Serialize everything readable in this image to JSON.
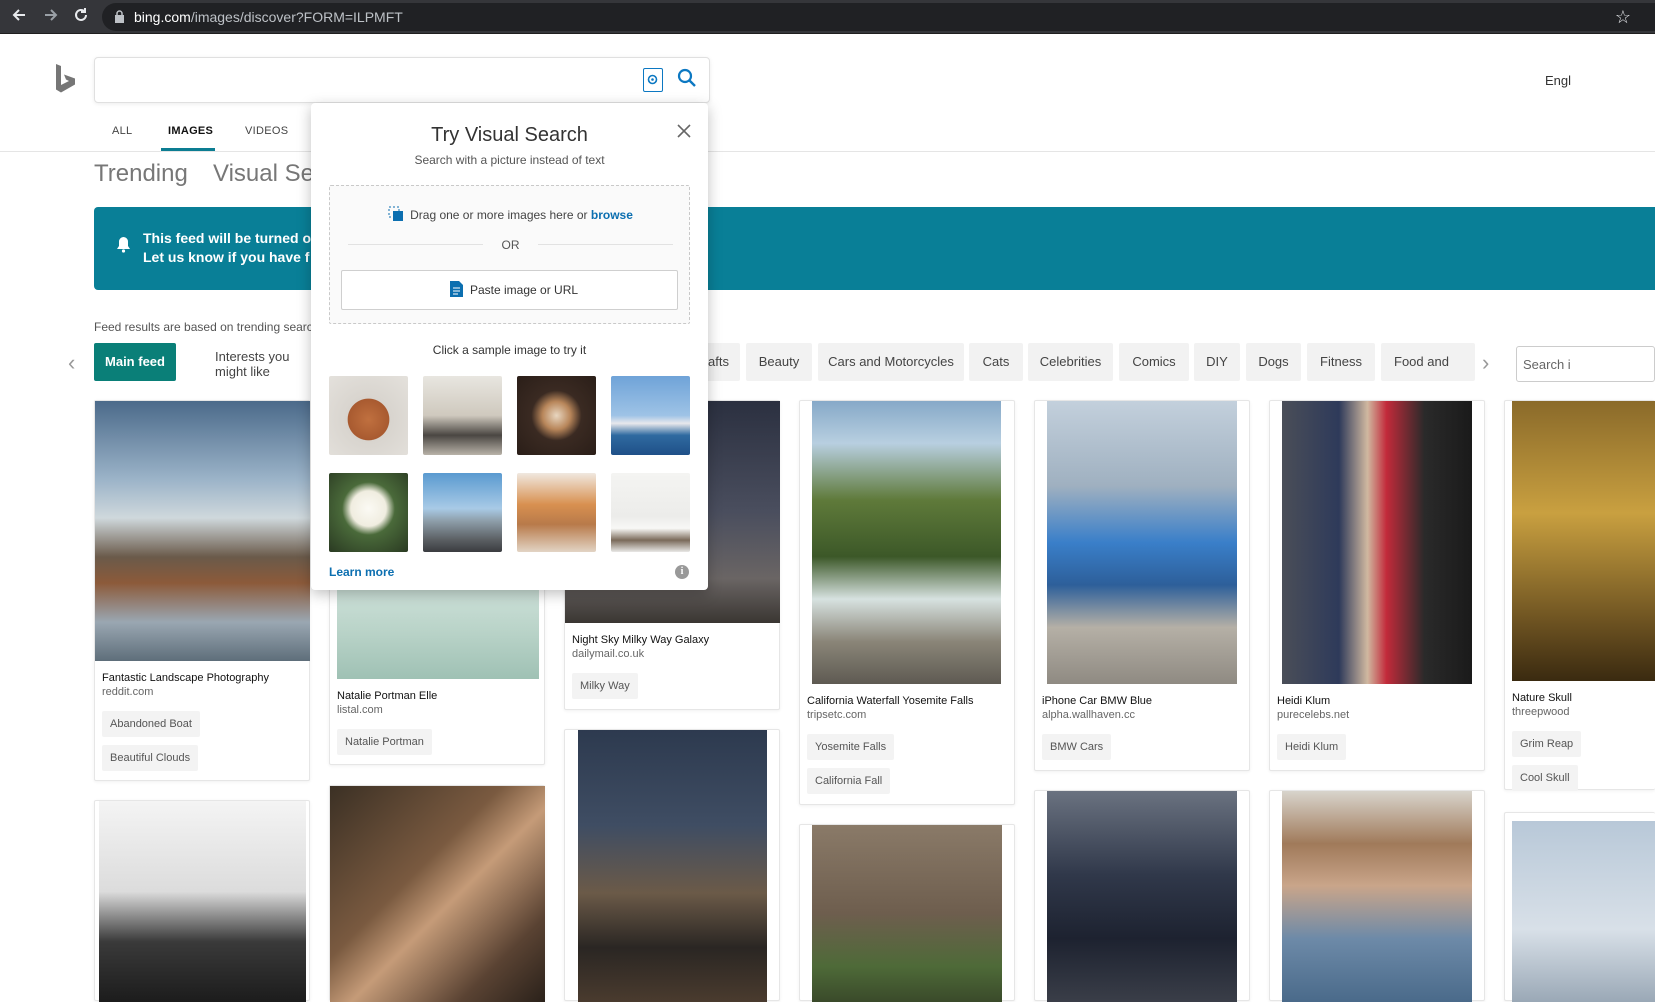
{
  "browser": {
    "url_domain": "bing.com",
    "url_path": "/images/discover?FORM=ILPMFT",
    "back_icon": "arrow-left-icon",
    "forward_icon": "arrow-right-icon",
    "reload_icon": "reload-icon",
    "bookmark_icon": "star-icon"
  },
  "header": {
    "logo": "bing-logo",
    "search_value": "",
    "language": "Engl"
  },
  "tabs": [
    {
      "label": "ALL"
    },
    {
      "label": "IMAGES",
      "active": true
    },
    {
      "label": "VIDEOS"
    }
  ],
  "subnav": {
    "trending": "Trending",
    "visual_search": "Visual Sea"
  },
  "banner": {
    "line1": "This feed will be turned o",
    "line2": "Let us know if you have f"
  },
  "feed_note": "Feed results are based on trending searc",
  "chips": {
    "main_feed": "Main feed",
    "interests": "Interests you might like",
    "items": [
      "afts",
      "Beauty",
      "Cars and Motorcycles",
      "Cats",
      "Celebrities",
      "Comics",
      "DIY",
      "Dogs",
      "Fitness",
      "Food and Drin"
    ],
    "search_placeholder": "Search i"
  },
  "cards": [
    {
      "title": "Fantastic Landscape Photography",
      "source": "reddit.com",
      "tags": [
        "Abandoned Boat",
        "Beautiful Clouds"
      ]
    },
    {
      "title": "Natalie Portman Elle",
      "source": "listal.com",
      "tags": [
        "Natalie Portman"
      ]
    },
    {
      "title": "Night Sky Milky Way Galaxy",
      "source": "dailymail.co.uk",
      "tags": [
        "Milky Way"
      ]
    },
    {
      "title": "California Waterfall Yosemite Falls",
      "source": "tripsetc.com",
      "tags": [
        "Yosemite Falls",
        "California Fall"
      ]
    },
    {
      "title": "iPhone Car BMW Blue",
      "source": "alpha.wallhaven.cc",
      "tags": [
        "BMW Cars"
      ]
    },
    {
      "title": "Heidi Klum",
      "source": "purecelebs.net",
      "tags": [
        "Heidi Klum"
      ]
    },
    {
      "title": "Nature Skull",
      "source": "threepwood",
      "tags": [
        "Grim Reap",
        "Cool Skull"
      ]
    }
  ],
  "popup": {
    "title": "Try Visual Search",
    "subtitle": "Search with a picture instead of text",
    "drag_text": "Drag one or more images here or ",
    "browse": "browse",
    "or": "OR",
    "paste": "Paste image or URL",
    "sample_title": "Click a sample image to try it",
    "learn_more": "Learn more",
    "samples": [
      "vase",
      "dining room",
      "coffee cups",
      "sydney opera house",
      "white rose",
      "louvre pyramid",
      "dogs",
      "white chair"
    ]
  },
  "colors": {
    "accent": "#097f97",
    "chip_active": "#0a7f78",
    "link": "#0c6fb0"
  }
}
